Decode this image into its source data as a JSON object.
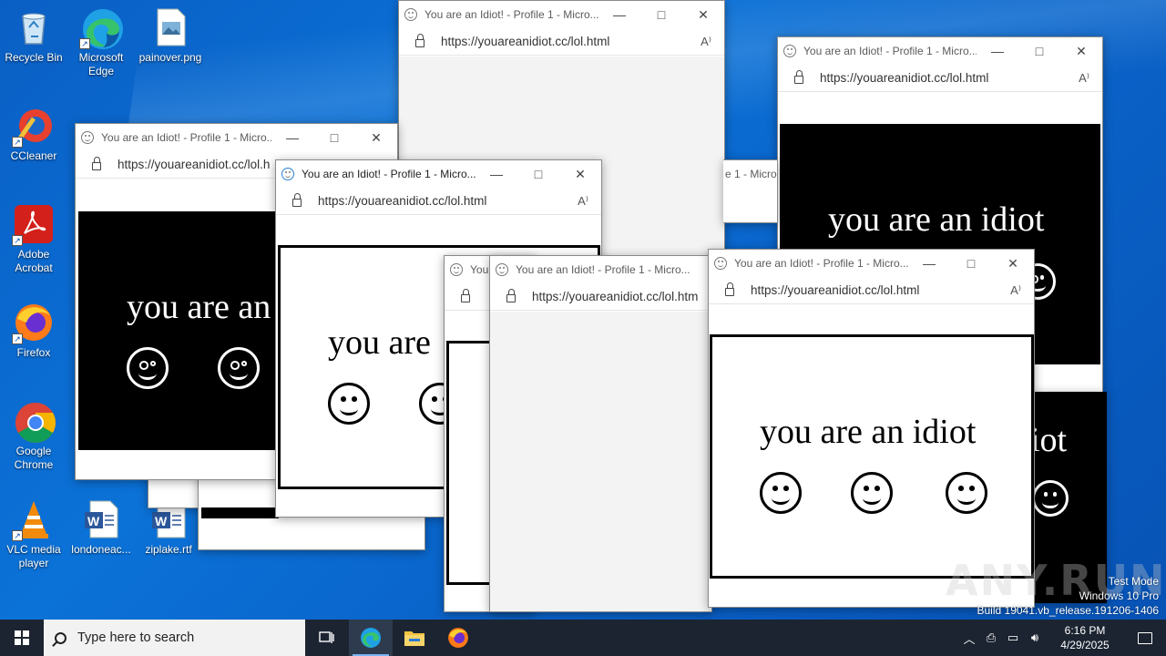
{
  "desktop_icons": [
    {
      "label": "Recycle Bin",
      "icon": "recycle-bin-icon"
    },
    {
      "label": "Microsoft Edge",
      "icon": "edge-icon"
    },
    {
      "label": "painover.png",
      "icon": "image-file-icon"
    },
    {
      "label": "CCleaner",
      "icon": "ccleaner-icon"
    },
    {
      "label": "Adobe Acrobat",
      "icon": "acrobat-icon"
    },
    {
      "label": "Firefox",
      "icon": "firefox-icon"
    },
    {
      "label": "Google Chrome",
      "icon": "chrome-icon"
    },
    {
      "label": "VLC media player",
      "icon": "vlc-icon"
    },
    {
      "label": "londoneac...",
      "icon": "word-doc-icon"
    },
    {
      "label": "ziplake.rtf",
      "icon": "word-doc-icon"
    }
  ],
  "browser": {
    "title": "You are an Idiot! - Profile 1 - Micro...",
    "title_short": "You",
    "title_partial": "e 1 - Micro",
    "url": "https://youareanidiot.cc/lol.html",
    "url_cut1": "https://youareanidiot.cc/lol.h",
    "url_cut2": "https://youareanidiot.cc/lol.htm",
    "read_aloud": "A⁾",
    "minimize": "—",
    "maximize": "□",
    "close": "✕"
  },
  "page": {
    "message": "you are an idiot",
    "message_cut1": "you are an",
    "message_cut2": "you are",
    "message_cut3": "iot"
  },
  "taskbar": {
    "search_placeholder": "Type here to search",
    "pinned": [
      "task-view",
      "edge",
      "file-explorer",
      "firefox"
    ],
    "time": "6:16 PM",
    "date": "4/29/2025"
  },
  "watermark": {
    "line1": "Test Mode",
    "line2": "Windows 10 Pro",
    "line3": "Build 19041.vb_release.191206-1406",
    "brand": "ANY.RUN"
  },
  "colors": {
    "desktop": "#0a66cc",
    "taskbar": "#1c2431",
    "panel_black": "#000000",
    "panel_white": "#ffffff"
  }
}
